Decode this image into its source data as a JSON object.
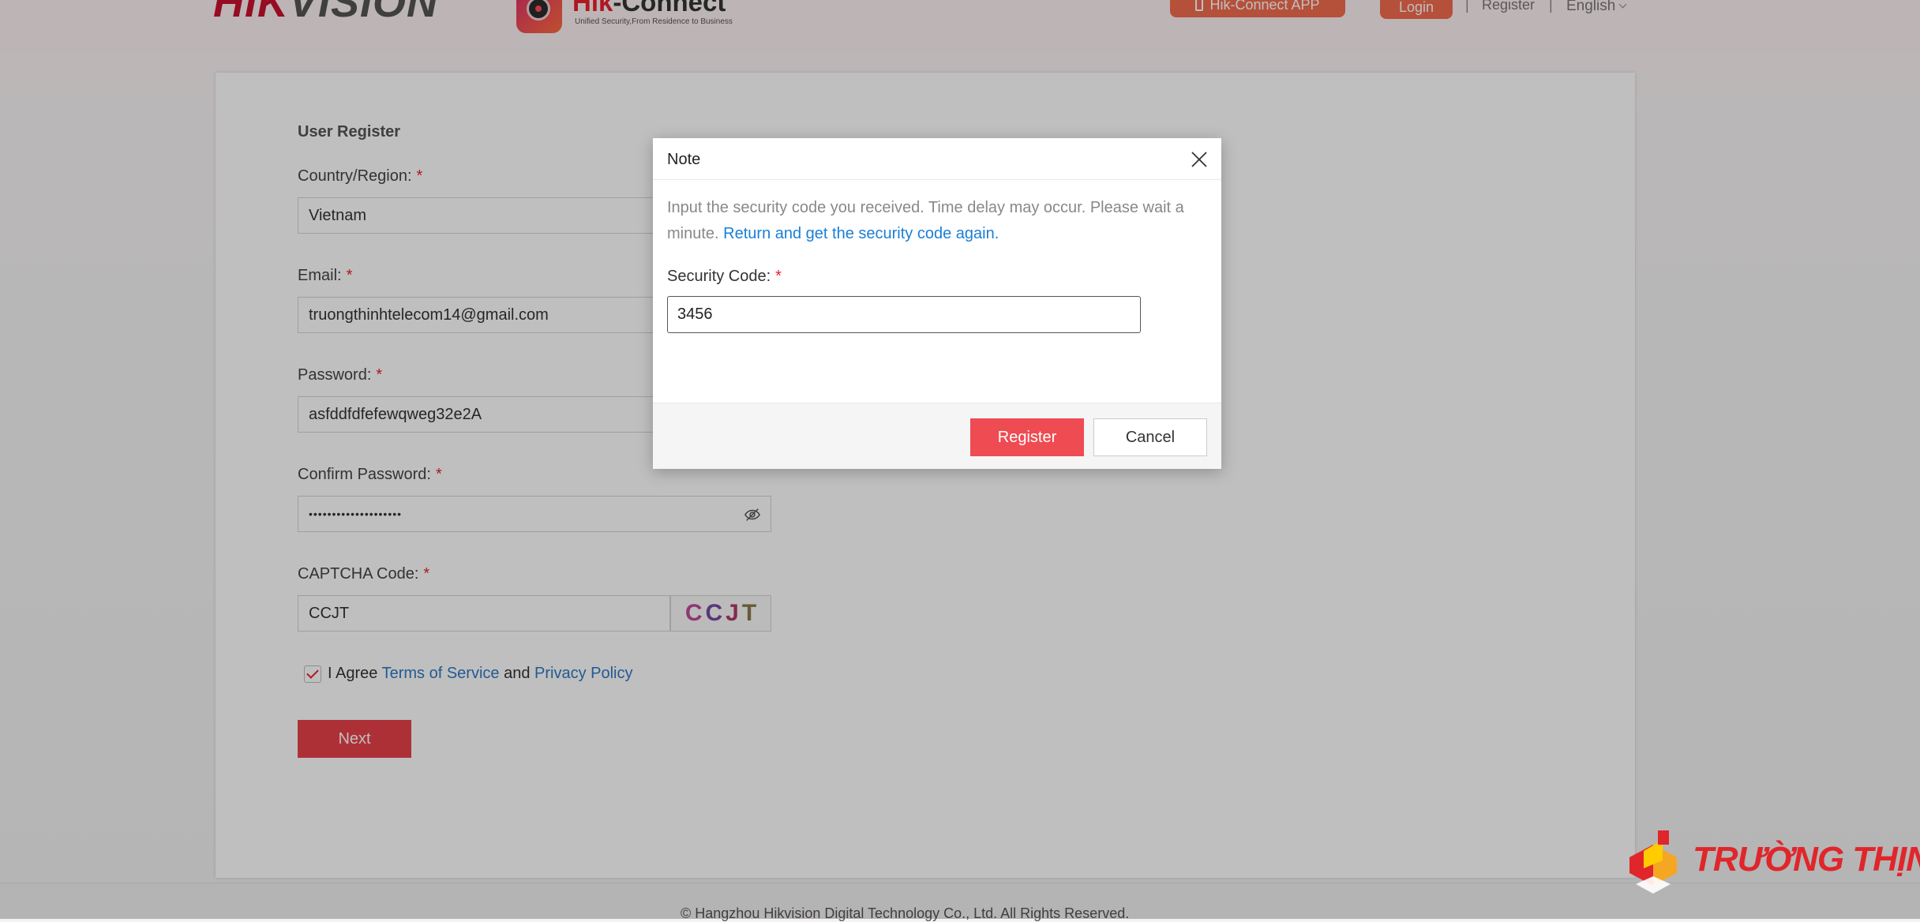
{
  "header": {
    "brand_hik": "HIK",
    "brand_vision": "VISION",
    "app_name_prefix": "Hik",
    "app_name_suffix": "-Connect",
    "app_slogan": "Unified Security,From Residence to Business",
    "app_button": "Hik-Connect APP",
    "login": "Login",
    "separator": "|",
    "register": "Register",
    "language": "English"
  },
  "form": {
    "title": "User Register",
    "required_mark": "*",
    "country_label": "Country/Region:",
    "country_value": "Vietnam",
    "email_label": "Email:",
    "email_value": "truongthinhtelecom14@gmail.com",
    "password_label": "Password:",
    "password_value": "asfddfdfefewqweg32e2A",
    "confirm_label": "Confirm Password:",
    "confirm_value": "••••••••••••••••••••",
    "captcha_label": "CAPTCHA Code:",
    "captcha_value": "CCJT",
    "captcha_chars": [
      "C",
      "C",
      "J",
      "T"
    ],
    "agree_prefix": "I Agree",
    "terms": "Terms of Service",
    "and": "and",
    "privacy": "Privacy Policy",
    "next": "Next"
  },
  "modal": {
    "title": "Note",
    "message": "Input the security code you received. Time delay may occur. Please wait a minute.",
    "link": "Return and get the security code again.",
    "code_label": "Security Code:",
    "code_value": "3456",
    "register": "Register",
    "cancel": "Cancel"
  },
  "footer": {
    "copyright": "© Hangzhou Hikvision Digital Technology Co., Ltd. All Rights Reserved."
  },
  "watermark": {
    "text": "TRƯỜNG THỊNH"
  },
  "colors": {
    "brand_red": "#e8212d",
    "accent_orange": "#f26b4f",
    "link_blue": "#1a7fd6"
  }
}
